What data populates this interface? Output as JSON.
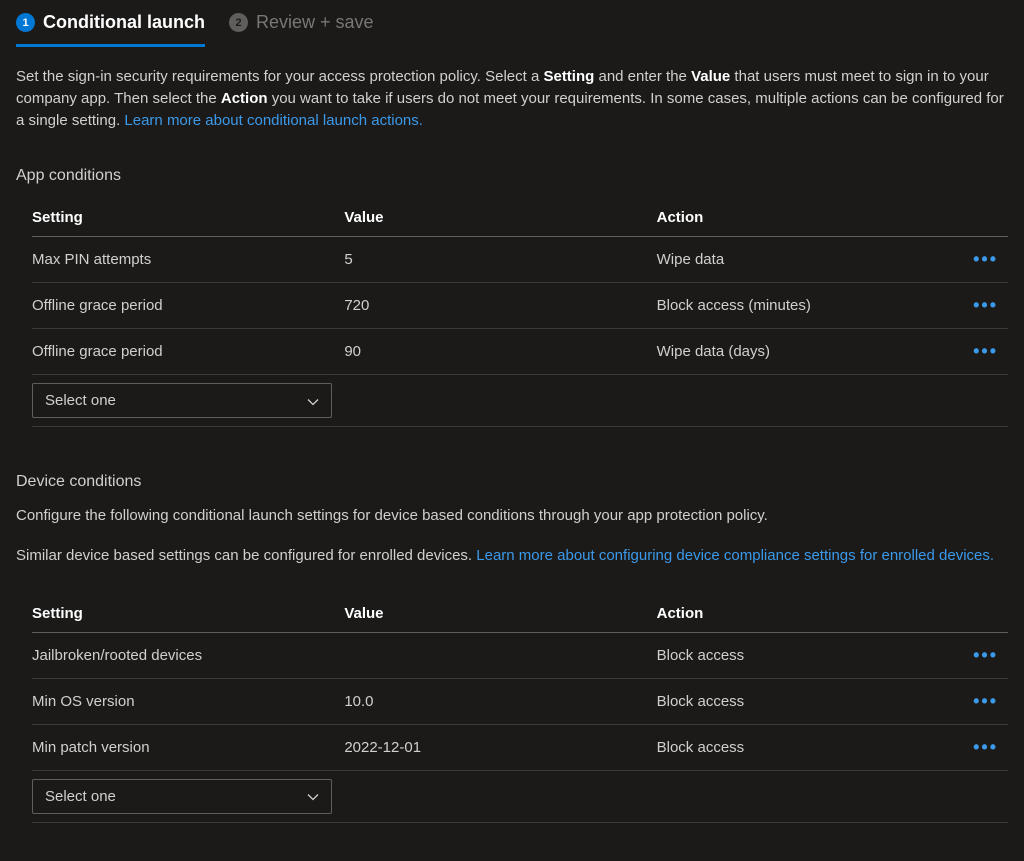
{
  "tabs": {
    "step1": {
      "num": "1",
      "label": "Conditional launch"
    },
    "step2": {
      "num": "2",
      "label": "Review + save"
    }
  },
  "intro": {
    "part1": "Set the sign-in security requirements for your access protection policy. Select a ",
    "bold1": "Setting",
    "part2": " and enter the ",
    "bold2": "Value",
    "part3": " that users must meet to sign in to your company app. Then select the ",
    "bold3": "Action",
    "part4": " you want to take if users do not meet your requirements. In some cases, multiple actions can be configured for a single setting. ",
    "link": "Learn more about conditional launch actions."
  },
  "app_conditions": {
    "title": "App conditions",
    "headers": {
      "setting": "Setting",
      "value": "Value",
      "action": "Action"
    },
    "rows": [
      {
        "setting": "Max PIN attempts",
        "value": "5",
        "action": "Wipe data"
      },
      {
        "setting": "Offline grace period",
        "value": "720",
        "action": "Block access (minutes)"
      },
      {
        "setting": "Offline grace period",
        "value": "90",
        "action": "Wipe data (days)"
      }
    ],
    "select_placeholder": "Select one"
  },
  "device_conditions": {
    "title": "Device conditions",
    "subtitle": "Configure the following conditional launch settings for device based conditions through your app protection policy.",
    "note_part1": "Similar device based settings can be configured for enrolled devices. ",
    "note_link": "Learn more about configuring device compliance settings for enrolled devices.",
    "headers": {
      "setting": "Setting",
      "value": "Value",
      "action": "Action"
    },
    "rows": [
      {
        "setting": "Jailbroken/rooted devices",
        "value": "",
        "action": "Block access"
      },
      {
        "setting": "Min OS version",
        "value": "10.0",
        "action": "Block access"
      },
      {
        "setting": "Min patch version",
        "value": "2022-12-01",
        "action": "Block access"
      }
    ],
    "select_placeholder": "Select one"
  }
}
